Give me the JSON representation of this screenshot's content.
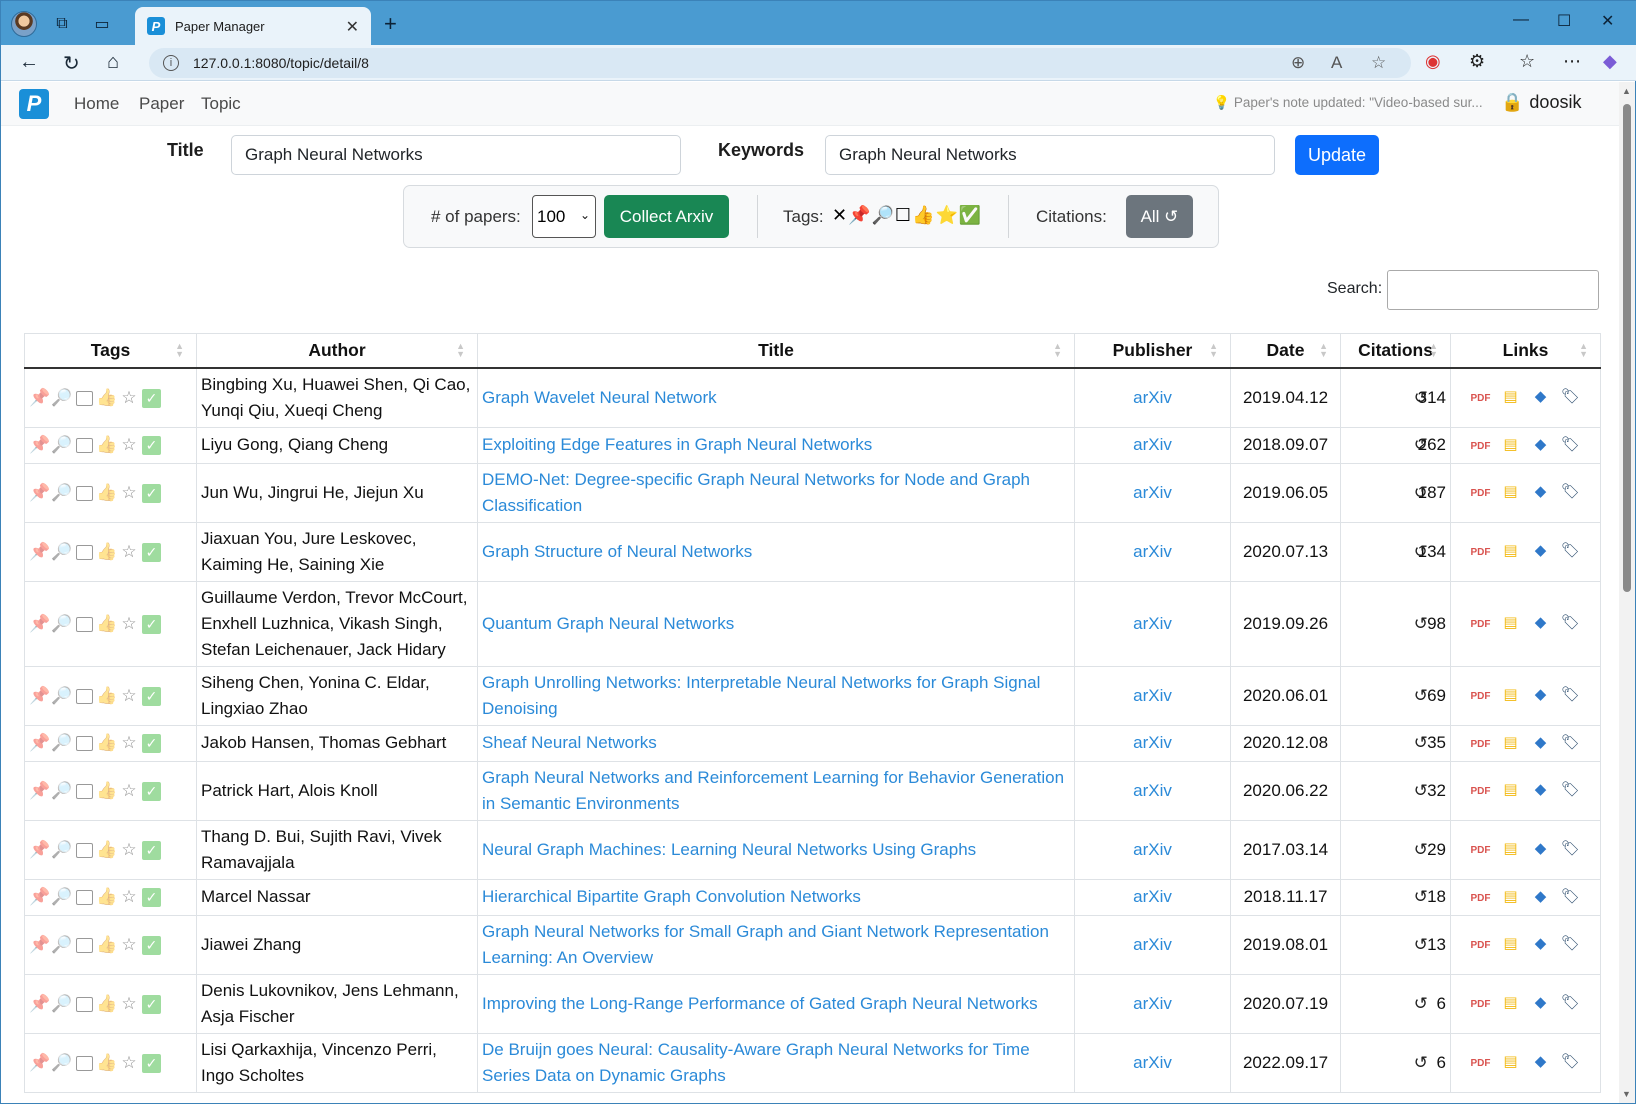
{
  "browser": {
    "tab_title": "Paper Manager",
    "url": "127.0.0.1:8080/topic/detail/8"
  },
  "navbar": {
    "brand": "P",
    "links": [
      "Home",
      "Paper",
      "Topic"
    ],
    "notice": "Paper's note updated: \"Video-based sur...",
    "user": "doosik"
  },
  "form": {
    "title_label": "Title",
    "title_value": "Graph Neural Networks",
    "keywords_label": "Keywords",
    "keywords_value": "Graph Neural Networks",
    "update_label": "Update"
  },
  "toolbar": {
    "papers_label": "# of papers:",
    "papers_value": "100",
    "collect_label": "Collect Arxiv",
    "tags_label": "Tags:",
    "tags_icons": "✕📌🔎☐👍⭐✅",
    "citations_label": "Citations:",
    "citations_button": "All ↺"
  },
  "search": {
    "label": "Search:"
  },
  "table": {
    "headers": [
      "Tags",
      "Author",
      "Title",
      "Publisher",
      "Date",
      "Citations",
      "Links"
    ],
    "rows": [
      {
        "author": "Bingbing Xu, Huawei Shen, Qi Cao, Yunqi Qiu, Xueqi Cheng",
        "title": "Graph Wavelet Neural Network",
        "publisher": "arXiv",
        "date": "2019.04.12",
        "citations": "314"
      },
      {
        "author": "Liyu Gong, Qiang Cheng",
        "title": "Exploiting Edge Features in Graph Neural Networks",
        "publisher": "arXiv",
        "date": "2018.09.07",
        "citations": "262"
      },
      {
        "author": "Jun Wu, Jingrui He, Jiejun Xu",
        "title": "DEMO-Net: Degree-specific Graph Neural Networks for Node and Graph Classification",
        "publisher": "arXiv",
        "date": "2019.06.05",
        "citations": "187"
      },
      {
        "author": "Jiaxuan You, Jure Leskovec, Kaiming He, Saining Xie",
        "title": "Graph Structure of Neural Networks",
        "publisher": "arXiv",
        "date": "2020.07.13",
        "citations": "134"
      },
      {
        "author": "Guillaume Verdon, Trevor McCourt, Enxhell Luzhnica, Vikash Singh, Stefan Leichenauer, Jack Hidary",
        "title": "Quantum Graph Neural Networks",
        "publisher": "arXiv",
        "date": "2019.09.26",
        "citations": "98"
      },
      {
        "author": "Siheng Chen, Yonina C. Eldar, Lingxiao Zhao",
        "title": "Graph Unrolling Networks: Interpretable Neural Networks for Graph Signal Denoising",
        "publisher": "arXiv",
        "date": "2020.06.01",
        "citations": "69"
      },
      {
        "author": "Jakob Hansen, Thomas Gebhart",
        "title": "Sheaf Neural Networks",
        "publisher": "arXiv",
        "date": "2020.12.08",
        "citations": "35"
      },
      {
        "author": "Patrick Hart, Alois Knoll",
        "title": "Graph Neural Networks and Reinforcement Learning for Behavior Generation in Semantic Environments",
        "publisher": "arXiv",
        "date": "2020.06.22",
        "citations": "32"
      },
      {
        "author": "Thang D. Bui, Sujith Ravi, Vivek Ramavajjala",
        "title": "Neural Graph Machines: Learning Neural Networks Using Graphs",
        "publisher": "arXiv",
        "date": "2017.03.14",
        "citations": "29"
      },
      {
        "author": "Marcel Nassar",
        "title": "Hierarchical Bipartite Graph Convolution Networks",
        "publisher": "arXiv",
        "date": "2018.11.17",
        "citations": "18"
      },
      {
        "author": "Jiawei Zhang",
        "title": "Graph Neural Networks for Small Graph and Giant Network Representation Learning: An Overview",
        "publisher": "arXiv",
        "date": "2019.08.01",
        "citations": "13"
      },
      {
        "author": "Denis Lukovnikov, Jens Lehmann, Asja Fischer",
        "title": "Improving the Long-Range Performance of Gated Graph Neural Networks",
        "publisher": "arXiv",
        "date": "2020.07.19",
        "citations": "6"
      },
      {
        "author": "Lisi Qarkaxhija, Vincenzo Perri, Ingo Scholtes",
        "title": "De Bruijn goes Neural: Causality-Aware Graph Neural Networks for Time Series Data on Dynamic Graphs",
        "publisher": "arXiv",
        "date": "2022.09.17",
        "citations": "6"
      }
    ]
  }
}
